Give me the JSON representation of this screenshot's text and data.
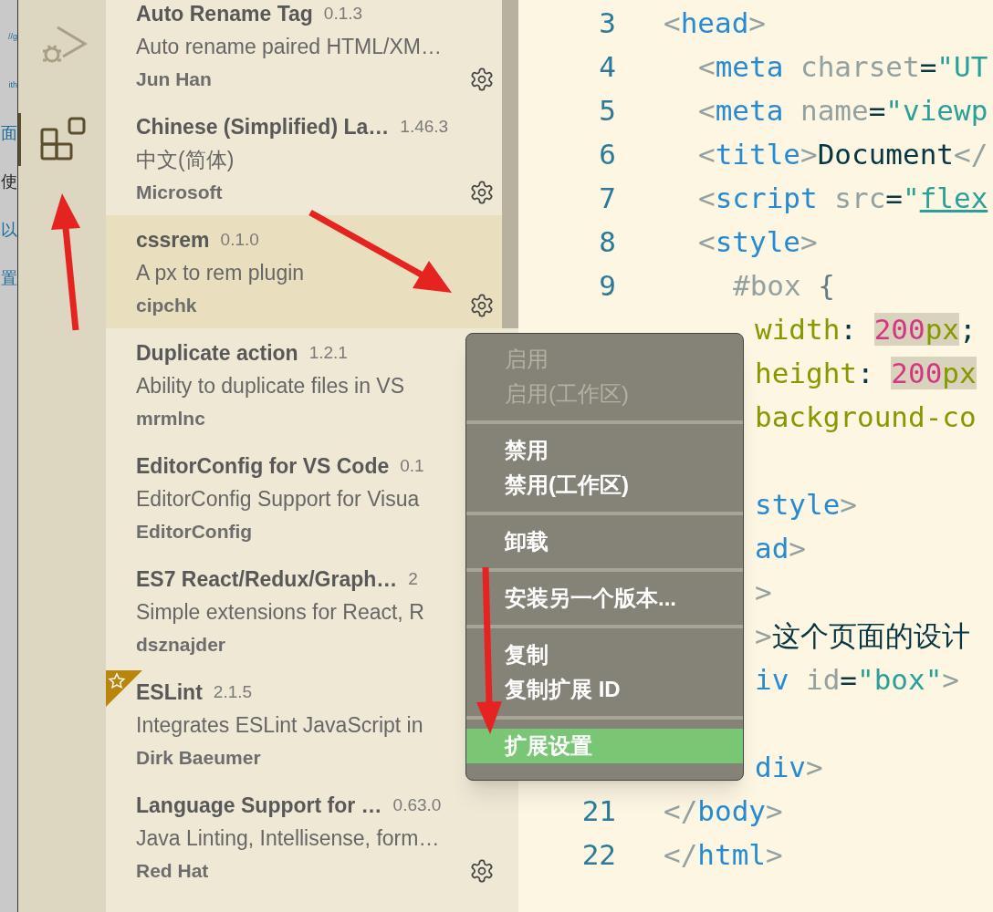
{
  "background_window": {
    "fragments": [
      {
        "text": "//g",
        "kind": "link"
      },
      {
        "text": "ith",
        "kind": "link"
      },
      {
        "text": "面",
        "kind": "link"
      },
      {
        "text": "使",
        "kind": "plain"
      },
      {
        "text": "以",
        "kind": "link"
      },
      {
        "text": "置",
        "kind": "link"
      }
    ]
  },
  "activity_bar": {
    "items": [
      {
        "kind": "debug",
        "selected": false
      },
      {
        "kind": "extensions",
        "selected": true
      }
    ]
  },
  "extensions": [
    {
      "name": "Auto Rename Tag",
      "version": "0.1.3",
      "description": "Auto rename paired HTML/XM…",
      "publisher": "Jun Han",
      "gear": true,
      "selected": false,
      "starred": false
    },
    {
      "name": "Chinese (Simplified) La…",
      "version": "1.46.3",
      "description": "中文(简体)",
      "publisher": "Microsoft",
      "gear": true,
      "selected": false,
      "starred": false
    },
    {
      "name": "cssrem",
      "version": "0.1.0",
      "description": "A px to rem plugin",
      "publisher": "cipchk",
      "gear": true,
      "selected": true,
      "starred": false
    },
    {
      "name": "Duplicate action",
      "version": "1.2.1",
      "description": "Ability to duplicate files in VS",
      "publisher": "mrmlnc",
      "gear": false,
      "selected": false,
      "starred": false
    },
    {
      "name": "EditorConfig for VS Code",
      "version": "0.1",
      "description": "EditorConfig Support for Visua",
      "publisher": "EditorConfig",
      "gear": false,
      "selected": false,
      "starred": false
    },
    {
      "name": "ES7 React/Redux/Graph…",
      "version": "2",
      "description": "Simple extensions for React, R",
      "publisher": "dsznajder",
      "gear": false,
      "selected": false,
      "starred": false
    },
    {
      "name": "ESLint",
      "version": "2.1.5",
      "description": "Integrates ESLint JavaScript in",
      "publisher": "Dirk Baeumer",
      "gear": false,
      "selected": false,
      "starred": true
    },
    {
      "name": "Language Support for …",
      "version": "0.63.0",
      "description": "Java Linting, Intellisense, form…",
      "publisher": "Red Hat",
      "gear": true,
      "selected": false,
      "starred": false
    }
  ],
  "editor": {
    "lines": [
      {
        "kind": "top",
        "number": "3",
        "tokens": [
          {
            "kind": "punct",
            "text": "<"
          },
          {
            "kind": "tag",
            "text": "head"
          },
          {
            "kind": "punct",
            "text": ">"
          }
        ]
      },
      {
        "kind": "nested",
        "number": "4",
        "tokens": [
          {
            "kind": "punct",
            "text": "<"
          },
          {
            "kind": "tag",
            "text": "meta"
          },
          {
            "kind": "attr",
            "text": " charset"
          },
          {
            "kind": "eq",
            "text": "="
          },
          {
            "kind": "string",
            "text": "\"UT"
          }
        ]
      },
      {
        "kind": "nested",
        "number": "5",
        "tokens": [
          {
            "kind": "punct",
            "text": "<"
          },
          {
            "kind": "tag",
            "text": "meta"
          },
          {
            "kind": "attr",
            "text": " name"
          },
          {
            "kind": "eq",
            "text": "="
          },
          {
            "kind": "string",
            "text": "\"viewp"
          }
        ]
      },
      {
        "kind": "nested",
        "number": "6",
        "tokens": [
          {
            "kind": "punct",
            "text": "<"
          },
          {
            "kind": "tag",
            "text": "title"
          },
          {
            "kind": "punct",
            "text": ">"
          },
          {
            "kind": "text",
            "text": "Document"
          },
          {
            "kind": "punct",
            "text": "</"
          }
        ]
      },
      {
        "kind": "nested",
        "number": "7",
        "tokens": [
          {
            "kind": "punct",
            "text": "<"
          },
          {
            "kind": "tag",
            "text": "script"
          },
          {
            "kind": "attr",
            "text": " src"
          },
          {
            "kind": "eq",
            "text": "="
          },
          {
            "kind": "string",
            "text": "\""
          },
          {
            "kind": "link",
            "text": "flex"
          }
        ]
      },
      {
        "kind": "nested",
        "number": "8",
        "tokens": [
          {
            "kind": "punct",
            "text": "<"
          },
          {
            "kind": "tag",
            "text": "style"
          },
          {
            "kind": "punct",
            "text": ">"
          }
        ]
      },
      {
        "kind": "nested2",
        "number": "9",
        "tokens": [
          {
            "kind": "attr",
            "text": "#box "
          },
          {
            "kind": "brace",
            "text": "{"
          }
        ]
      },
      {
        "kind": "covered",
        "tokens": [
          {
            "kind": "prop",
            "text": "width"
          },
          {
            "kind": "eq",
            "text": ": "
          },
          {
            "kind": "num",
            "text": "200",
            "highlight": true
          },
          {
            "kind": "prop",
            "text": "px",
            "highlight": true
          },
          {
            "kind": "eq",
            "text": ";"
          }
        ]
      },
      {
        "kind": "covered",
        "tokens": [
          {
            "kind": "prop",
            "text": "height"
          },
          {
            "kind": "eq",
            "text": ": "
          },
          {
            "kind": "num",
            "text": "200",
            "highlight": true
          },
          {
            "kind": "prop",
            "text": "px",
            "highlight": true
          }
        ]
      },
      {
        "kind": "covered",
        "tokens": [
          {
            "kind": "prop",
            "text": "background-co"
          }
        ]
      },
      {
        "kind": "blank"
      },
      {
        "kind": "covered",
        "tokens": [
          {
            "kind": "tag",
            "text": "style"
          },
          {
            "kind": "punct",
            "text": ">"
          }
        ]
      },
      {
        "kind": "covered",
        "tokens": [
          {
            "kind": "tag",
            "text": "ad"
          },
          {
            "kind": "punct",
            "text": ">"
          }
        ]
      },
      {
        "kind": "covered",
        "tokens": [
          {
            "kind": "punct",
            "text": ">"
          }
        ]
      },
      {
        "kind": "covered",
        "tokens": [
          {
            "kind": "punct",
            "text": ">"
          },
          {
            "kind": "text",
            "text": "这个页面的设计"
          }
        ]
      },
      {
        "kind": "covered",
        "tokens": [
          {
            "kind": "tag",
            "text": "iv"
          },
          {
            "kind": "attr",
            "text": " id"
          },
          {
            "kind": "eq",
            "text": "="
          },
          {
            "kind": "string",
            "text": "\"box\""
          },
          {
            "kind": "punct",
            "text": ">"
          }
        ]
      },
      {
        "kind": "blank"
      },
      {
        "kind": "covered",
        "tokens": [
          {
            "kind": "tag",
            "text": "div"
          },
          {
            "kind": "punct",
            "text": ">"
          }
        ]
      },
      {
        "kind": "top",
        "number": "21",
        "tokens": [
          {
            "kind": "punct",
            "text": "</"
          },
          {
            "kind": "tag",
            "text": "body"
          },
          {
            "kind": "punct",
            "text": ">"
          }
        ]
      },
      {
        "kind": "top",
        "number": "22",
        "tokens": [
          {
            "kind": "punct",
            "text": "</"
          },
          {
            "kind": "tag",
            "text": "html"
          },
          {
            "kind": "punct",
            "text": ">"
          }
        ]
      }
    ]
  },
  "context_menu": {
    "groups": [
      {
        "items": [
          {
            "label": "启用",
            "disabled": true,
            "selected": false
          },
          {
            "label": "启用(工作区)",
            "disabled": true,
            "selected": false
          }
        ]
      },
      {
        "items": [
          {
            "label": "禁用",
            "disabled": false,
            "selected": false
          },
          {
            "label": "禁用(工作区)",
            "disabled": false,
            "selected": false
          }
        ]
      },
      {
        "items": [
          {
            "label": "卸载",
            "disabled": false,
            "selected": false
          }
        ]
      },
      {
        "items": [
          {
            "label": "安装另一个版本...",
            "disabled": false,
            "selected": false
          }
        ]
      },
      {
        "items": [
          {
            "label": "复制",
            "disabled": false,
            "selected": false
          },
          {
            "label": "复制扩展 ID",
            "disabled": false,
            "selected": false
          }
        ]
      },
      {
        "items": [
          {
            "label": "扩展设置",
            "disabled": false,
            "selected": true
          }
        ]
      }
    ]
  }
}
